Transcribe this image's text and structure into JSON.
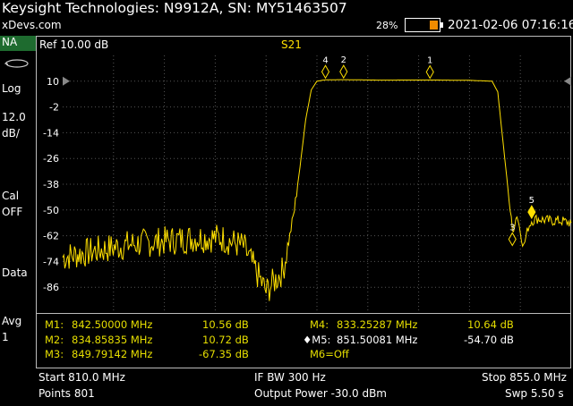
{
  "header": {
    "title": "Keysight Technologies: N9912A, SN: MY51463507",
    "site": "xDevs.com",
    "battery_pct": "28%",
    "datetime": "2021-02-06 07:16:16"
  },
  "left_panel": {
    "mode_tab": "NA",
    "format": "Log",
    "scale_value": "12.0",
    "scale_unit": "dB/",
    "cal_label": "Cal",
    "cal_state": "OFF",
    "data_label": "Data",
    "avg_label": "Avg",
    "avg_value": "1"
  },
  "plot": {
    "ref_label": "Ref 10.00 dB",
    "trace_name": "S21",
    "trace_color": "#ffe000",
    "y_tick_labels": [
      "10",
      "-2",
      "-14",
      "-26",
      "-38",
      "-50",
      "-62",
      "-74",
      "-86"
    ]
  },
  "chart_data": {
    "type": "line",
    "x_start_mhz": 810.0,
    "x_stop_mhz": 855.0,
    "ylim": [
      -98,
      22
    ],
    "y_ticks": [
      10,
      -2,
      -14,
      -26,
      -38,
      -50,
      -62,
      -74,
      -86
    ],
    "grid": true,
    "series": [
      {
        "x": [
          810.0,
          812.0,
          814.0,
          816.0,
          818.0,
          820.0,
          822.0,
          824.0,
          826.0,
          828.0,
          829.5,
          830.0,
          830.5,
          831.0,
          831.5,
          832.0,
          832.5,
          833.25,
          834.86,
          838.0,
          842.5,
          846.0,
          848.0,
          848.5,
          849.0,
          849.5,
          849.8,
          850.2,
          850.5,
          850.8,
          851.2,
          851.5,
          852.0,
          853.0,
          854.0,
          855.0
        ],
        "y": [
          -72,
          -70,
          -68,
          -66,
          -65,
          -64,
          -63,
          -63,
          -67,
          -88,
          -78,
          -65,
          -50,
          -30,
          -8,
          6,
          10,
          10.64,
          10.72,
          10.5,
          10.56,
          10.4,
          10,
          5,
          -20,
          -45,
          -60,
          -52,
          -60,
          -67,
          -58,
          -55,
          -54,
          -55,
          -55,
          -56
        ]
      }
    ],
    "markers": [
      {
        "id": "1",
        "freq_mhz": 842.5,
        "value_db": 10.56
      },
      {
        "id": "2",
        "freq_mhz": 834.85835,
        "value_db": 10.72
      },
      {
        "id": "3",
        "freq_mhz": 849.79142,
        "value_db": -67.35
      },
      {
        "id": "4",
        "freq_mhz": 833.25287,
        "value_db": 10.64
      },
      {
        "id": "5",
        "freq_mhz": 851.50081,
        "value_db": -54.7,
        "active": true
      }
    ]
  },
  "marker_table": {
    "rows": [
      {
        "name": "M1:",
        "freq": "842.50000 MHz",
        "value": "10.56 dB"
      },
      {
        "name": "M2:",
        "freq": "834.85835 MHz",
        "value": "10.72 dB"
      },
      {
        "name": "M3:",
        "freq": "849.79142 MHz",
        "value": "-67.35 dB"
      },
      {
        "name": "M4:",
        "freq": "833.25287 MHz",
        "value": "10.64 dB"
      },
      {
        "name": "♦M5:",
        "freq": "851.50081 MHz",
        "value": "-54.70 dB"
      },
      {
        "name": "M6=Off",
        "freq": "",
        "value": ""
      }
    ]
  },
  "status": {
    "start": "Start 810.0 MHz",
    "points": "Points 801",
    "ifbw": "IF BW 300 Hz",
    "power": "Output Power -30.0 dBm",
    "stop": "Stop 855.0 MHz",
    "sweep": "Swp 5.50 s"
  }
}
